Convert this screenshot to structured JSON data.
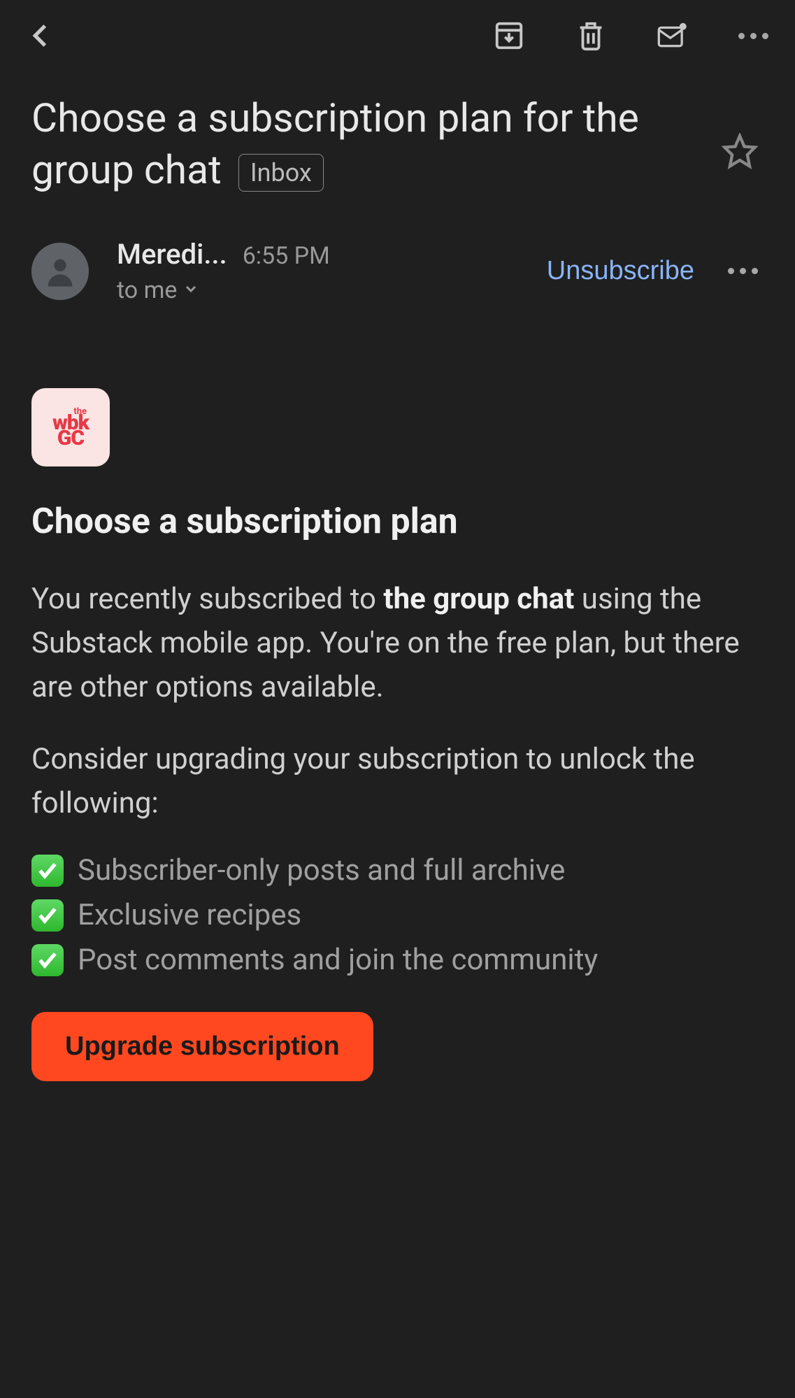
{
  "toolbar": {
    "back_label": "Back",
    "archive_label": "Archive",
    "delete_label": "Delete",
    "mark_unread_label": "Mark unread",
    "more_label": "More options"
  },
  "subject": {
    "title": "Choose a subscription plan for the group chat",
    "label": "Inbox",
    "star_label": "Star"
  },
  "sender": {
    "name": "Meredi...",
    "time": "6:55 PM",
    "recipient": "to me",
    "unsubscribe": "Unsubscribe",
    "more_label": "More"
  },
  "brand": {
    "line1": "the",
    "line2": "wbk",
    "line3": "GC"
  },
  "body": {
    "heading": "Choose a subscription plan",
    "para1_pre": "You recently subscribed to ",
    "para1_strong": "the group chat",
    "para1_post": " using the Substack mobile app. You're on the free plan, but there are other options available.",
    "para2": "Consider upgrading your subscription to unlock the following:",
    "features": [
      "Subscriber-only posts and full archive",
      "Exclusive recipes",
      "Post comments and join the community"
    ],
    "cta": "Upgrade subscription"
  }
}
